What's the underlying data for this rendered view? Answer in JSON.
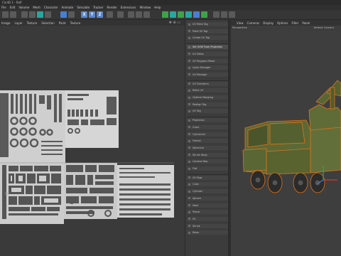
{
  "app": {
    "title": "Cin4D 1 - Rafi"
  },
  "menubar": {
    "items": [
      "File",
      "Edit",
      "Volume",
      "Mesh",
      "Character",
      "Animate",
      "Simulate",
      "Tracker",
      "Render",
      "Extensions",
      "Window",
      "Help"
    ]
  },
  "uv_editor": {
    "menu": [
      "Image",
      "Layer",
      "Texture",
      "Selection",
      "Paint",
      "Texture"
    ],
    "status_label": "0/0"
  },
  "attributes": {
    "rows": [
      "UV Mesh Tag",
      "Paint UV Tag",
      "Create UV Tag",
      "Set UVW From Projection",
      "UV Editor",
      "UV Polygons Mode",
      "Layer Manager",
      "UV Manager",
      "UV Transform",
      "Relax UV",
      "Optimal Mapping",
      "Realign Tag",
      "UV Tag",
      "Projection",
      "Cubic",
      "Cylindrical",
      "Frontal",
      "Spherical",
      "Shrink Wrap",
      "Camera Map",
      "Flat",
      "UV Tags",
      "Cube",
      "Cylinder",
      "Sphere",
      "Ideal",
      "Planar",
      "Fit",
      "Shrink",
      "Relax"
    ],
    "selected_index": 3
  },
  "viewport": {
    "menu": [
      "View",
      "Cameras",
      "Display",
      "Options",
      "Filter",
      "Panel"
    ],
    "name": "Perspective",
    "camera": "Default Camera"
  },
  "colors": {
    "accent_blue": "#4a7fd0",
    "truck_body": "#5e6a36",
    "selection_orange": "#e0741a",
    "uv_island_fill": "#cfcfcf"
  },
  "icons": [
    "undo-icon",
    "redo-icon",
    "model-mode-icon",
    "points-mode-icon",
    "edges-mode-icon",
    "polygons-mode-icon",
    "axis-x-icon",
    "axis-y-icon",
    "axis-z-icon",
    "move-icon",
    "scale-icon",
    "rotate-icon",
    "render-icon",
    "cube-icon",
    "light-icon",
    "camera-icon"
  ]
}
